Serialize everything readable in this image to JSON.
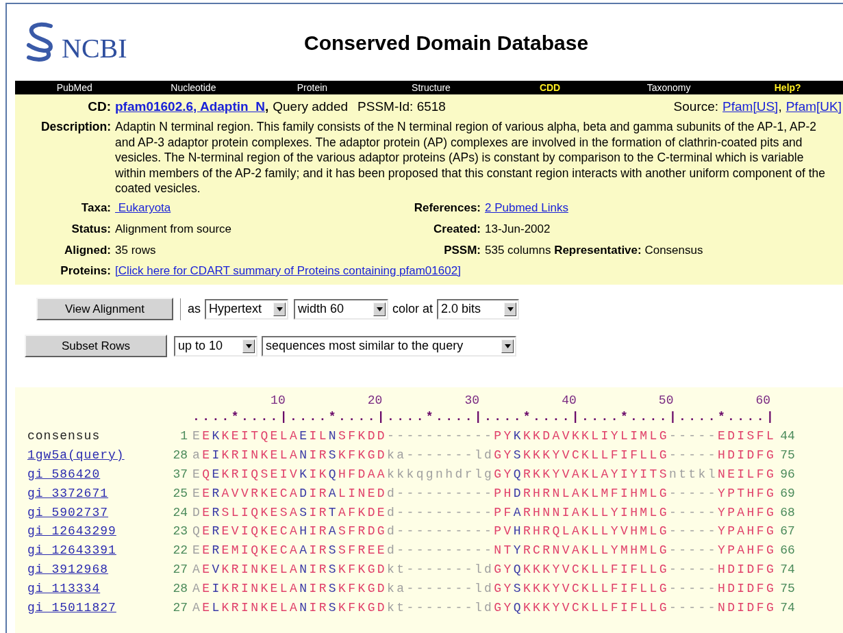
{
  "header": {
    "logo_text": "NCBI",
    "title": "Conserved Domain Database"
  },
  "nav": [
    {
      "label": "PubMed",
      "emphasized": false
    },
    {
      "label": "Nucleotide",
      "emphasized": false
    },
    {
      "label": "Protein",
      "emphasized": false
    },
    {
      "label": "Structure",
      "emphasized": false
    },
    {
      "label": "CDD",
      "emphasized": true
    },
    {
      "label": "Taxonomy",
      "emphasized": false
    },
    {
      "label": "Help?",
      "emphasized": true
    }
  ],
  "cd": {
    "label": "CD:",
    "link": "pfam01602.6, Adaptin_N",
    "comma": ",",
    "note": "Query added",
    "pssm_id": "PSSM-Id: 6518",
    "source_label": "Source:",
    "sources": [
      "Pfam[US]",
      "Pfam[UK]"
    ],
    "source_separator": ","
  },
  "description": {
    "label": "Description:",
    "text": "Adaptin N terminal region. This family consists of the N terminal region of various alpha, beta and gamma subunits of the AP-1, AP-2 and AP-3 adaptor protein complexes. The adaptor protein (AP) complexes are involved in the formation of clathrin-coated pits and vesicles. The N-terminal region of the various adaptor proteins (APs) is constant by comparison to the C-terminal which is variable within members of the AP-2 family; and it has been proposed that this constant region interacts with another uniform component of the coated vesicles."
  },
  "fields": [
    {
      "left": {
        "label": "Taxa:",
        "value": " Eukaryota",
        "kind": "link"
      },
      "right": {
        "label": "References:",
        "value": "2 Pubmed Links",
        "kind": "link"
      }
    },
    {
      "left": {
        "label": "Status:",
        "value": "Alignment from source",
        "kind": "text"
      },
      "right": {
        "label": "Created:",
        "value": "13-Jun-2002",
        "kind": "text"
      }
    },
    {
      "left": {
        "label": "Aligned:",
        "value": "35 rows",
        "kind": "text"
      },
      "right": {
        "label": "PSSM:",
        "value": "535 columns **Representative:** Consensus",
        "kind": "text"
      }
    }
  ],
  "proteins": {
    "label": "Proteins:",
    "link": "[Click here for CDART summary of Proteins containing pfam01602]"
  },
  "controls": {
    "view_button": "View Alignment",
    "as_label": "as",
    "format": "Hypertext",
    "width": "width 60",
    "color_label": "color at",
    "bits": "2.0 bits",
    "subset_button": "Subset Rows",
    "rows": "up to 10",
    "similarity": "sequences most similar to the query"
  },
  "alignment": {
    "ticks": [
      "10",
      "20",
      "30",
      "40",
      "50",
      "60"
    ],
    "ruler": "....*....|....*....|....*....|....*....|....*....|....*....|",
    "rows": [
      {
        "name": "consensus",
        "kind": "plain",
        "start": "1",
        "end": "44",
        "segments": [
          {
            "kind": "low",
            "text": "E"
          },
          {
            "kind": "high",
            "text": "E"
          },
          {
            "kind": "mid",
            "text": "K"
          },
          {
            "kind": "high",
            "text": "KEITQELA"
          },
          {
            "kind": "mid",
            "text": "E"
          },
          {
            "kind": "high",
            "text": "IL"
          },
          {
            "kind": "mid",
            "text": "N"
          },
          {
            "kind": "high",
            "text": "SFKDD"
          },
          {
            "kind": "low",
            "text": "-----------"
          },
          {
            "kind": "high",
            "text": "PY"
          },
          {
            "kind": "mid",
            "text": "K"
          },
          {
            "kind": "high",
            "text": "KKDAVKKLIYLIMLG"
          },
          {
            "kind": "low",
            "text": "-----"
          },
          {
            "kind": "high",
            "text": "EDISFL"
          }
        ]
      },
      {
        "name": "1gw5a(query)",
        "kind": "link",
        "start": "28",
        "end": "75",
        "segments": [
          {
            "kind": "low",
            "text": "a"
          },
          {
            "kind": "high",
            "text": "E"
          },
          {
            "kind": "mid",
            "text": "I"
          },
          {
            "kind": "high",
            "text": "KRINKELA"
          },
          {
            "kind": "mid",
            "text": "N"
          },
          {
            "kind": "high",
            "text": "IR"
          },
          {
            "kind": "mid",
            "text": "S"
          },
          {
            "kind": "high",
            "text": "KFKGD"
          },
          {
            "kind": "low",
            "text": "ka-------ld"
          },
          {
            "kind": "high",
            "text": "GY"
          },
          {
            "kind": "mid",
            "text": "S"
          },
          {
            "kind": "high",
            "text": "KKKYVCKLLFIFLLG"
          },
          {
            "kind": "low",
            "text": "-----"
          },
          {
            "kind": "high",
            "text": "HDIDFG"
          }
        ]
      },
      {
        "name": "gi 586420",
        "kind": "link",
        "start": "37",
        "end": "96",
        "segments": [
          {
            "kind": "low",
            "text": "E"
          },
          {
            "kind": "high",
            "text": "Q"
          },
          {
            "kind": "mid",
            "text": "E"
          },
          {
            "kind": "high",
            "text": "KRIQSEIV"
          },
          {
            "kind": "mid",
            "text": "K"
          },
          {
            "kind": "high",
            "text": "IK"
          },
          {
            "kind": "mid",
            "text": "Q"
          },
          {
            "kind": "high",
            "text": "HFDAA"
          },
          {
            "kind": "low",
            "text": "kkkqgnhdrlg"
          },
          {
            "kind": "high",
            "text": "GY"
          },
          {
            "kind": "mid",
            "text": "Q"
          },
          {
            "kind": "high",
            "text": "RKKYVAKLAYIYITS"
          },
          {
            "kind": "low",
            "text": "nttkl"
          },
          {
            "kind": "high",
            "text": "NEILFG"
          }
        ]
      },
      {
        "name": "gi 3372671",
        "kind": "link",
        "start": "25",
        "end": "69",
        "segments": [
          {
            "kind": "low",
            "text": "E"
          },
          {
            "kind": "high",
            "text": "E"
          },
          {
            "kind": "mid",
            "text": "R"
          },
          {
            "kind": "high",
            "text": "AVVRKECA"
          },
          {
            "kind": "mid",
            "text": "D"
          },
          {
            "kind": "high",
            "text": "IR"
          },
          {
            "kind": "mid",
            "text": "A"
          },
          {
            "kind": "high",
            "text": "LINED"
          },
          {
            "kind": "low",
            "text": "d----------"
          },
          {
            "kind": "high",
            "text": "PH"
          },
          {
            "kind": "mid",
            "text": "D"
          },
          {
            "kind": "high",
            "text": "RHRNLAKLMFIHMLG"
          },
          {
            "kind": "low",
            "text": "-----"
          },
          {
            "kind": "high",
            "text": "YPTHFG"
          }
        ]
      },
      {
        "name": "gi 5902737",
        "kind": "link",
        "start": "24",
        "end": "68",
        "segments": [
          {
            "kind": "low",
            "text": "D"
          },
          {
            "kind": "high",
            "text": "E"
          },
          {
            "kind": "mid",
            "text": "R"
          },
          {
            "kind": "high",
            "text": "SLIQKESA"
          },
          {
            "kind": "mid",
            "text": "S"
          },
          {
            "kind": "high",
            "text": "IR"
          },
          {
            "kind": "mid",
            "text": "T"
          },
          {
            "kind": "high",
            "text": "AFKDE"
          },
          {
            "kind": "low",
            "text": "d----------"
          },
          {
            "kind": "high",
            "text": "PF"
          },
          {
            "kind": "mid",
            "text": "A"
          },
          {
            "kind": "high",
            "text": "RHNNIAKLLYIHMLG"
          },
          {
            "kind": "low",
            "text": "-----"
          },
          {
            "kind": "high",
            "text": "YPAHFG"
          }
        ]
      },
      {
        "name": "gi 12643299",
        "kind": "link",
        "start": "23",
        "end": "67",
        "segments": [
          {
            "kind": "low",
            "text": "Q"
          },
          {
            "kind": "high",
            "text": "E"
          },
          {
            "kind": "mid",
            "text": "R"
          },
          {
            "kind": "high",
            "text": "EVIQKECA"
          },
          {
            "kind": "mid",
            "text": "H"
          },
          {
            "kind": "high",
            "text": "IR"
          },
          {
            "kind": "mid",
            "text": "A"
          },
          {
            "kind": "high",
            "text": "SFRDG"
          },
          {
            "kind": "low",
            "text": "d----------"
          },
          {
            "kind": "high",
            "text": "PV"
          },
          {
            "kind": "mid",
            "text": "H"
          },
          {
            "kind": "high",
            "text": "RHRQLAKLLYVHMLG"
          },
          {
            "kind": "low",
            "text": "-----"
          },
          {
            "kind": "high",
            "text": "YPAHFG"
          }
        ]
      },
      {
        "name": "gi 12643391",
        "kind": "link",
        "start": "22",
        "end": "66",
        "segments": [
          {
            "kind": "low",
            "text": "E"
          },
          {
            "kind": "high",
            "text": "E"
          },
          {
            "kind": "mid",
            "text": "R"
          },
          {
            "kind": "high",
            "text": "EMIQKECA"
          },
          {
            "kind": "mid",
            "text": "A"
          },
          {
            "kind": "high",
            "text": "IR"
          },
          {
            "kind": "mid",
            "text": "S"
          },
          {
            "kind": "high",
            "text": "SFREE"
          },
          {
            "kind": "low",
            "text": "d----------"
          },
          {
            "kind": "high",
            "text": "NT"
          },
          {
            "kind": "mid",
            "text": "Y"
          },
          {
            "kind": "high",
            "text": "RCRNVAKLLYMHMLG"
          },
          {
            "kind": "low",
            "text": "-----"
          },
          {
            "kind": "high",
            "text": "YPAHFG"
          }
        ]
      },
      {
        "name": "gi 3912968",
        "kind": "link",
        "start": "27",
        "end": "74",
        "segments": [
          {
            "kind": "low",
            "text": "A"
          },
          {
            "kind": "high",
            "text": "E"
          },
          {
            "kind": "mid",
            "text": "V"
          },
          {
            "kind": "high",
            "text": "KRINKELA"
          },
          {
            "kind": "mid",
            "text": "N"
          },
          {
            "kind": "high",
            "text": "IR"
          },
          {
            "kind": "mid",
            "text": "S"
          },
          {
            "kind": "high",
            "text": "KFKGD"
          },
          {
            "kind": "low",
            "text": "kt-------ld"
          },
          {
            "kind": "high",
            "text": "GY"
          },
          {
            "kind": "mid",
            "text": "Q"
          },
          {
            "kind": "high",
            "text": "KKKYVCKLLFIFLLG"
          },
          {
            "kind": "low",
            "text": "-----"
          },
          {
            "kind": "high",
            "text": "HDIDFG"
          }
        ]
      },
      {
        "name": "gi 113334",
        "kind": "link",
        "start": "28",
        "end": "75",
        "segments": [
          {
            "kind": "low",
            "text": "A"
          },
          {
            "kind": "high",
            "text": "E"
          },
          {
            "kind": "mid",
            "text": "I"
          },
          {
            "kind": "high",
            "text": "KRINKELA"
          },
          {
            "kind": "mid",
            "text": "N"
          },
          {
            "kind": "high",
            "text": "IR"
          },
          {
            "kind": "mid",
            "text": "S"
          },
          {
            "kind": "high",
            "text": "KFKGD"
          },
          {
            "kind": "low",
            "text": "ka-------ld"
          },
          {
            "kind": "high",
            "text": "GY"
          },
          {
            "kind": "mid",
            "text": "S"
          },
          {
            "kind": "high",
            "text": "KKKYVCKLLFIFLLG"
          },
          {
            "kind": "low",
            "text": "-----"
          },
          {
            "kind": "high",
            "text": "HDIDFG"
          }
        ]
      },
      {
        "name": "gi 15011827",
        "kind": "link",
        "start": "27",
        "end": "74",
        "segments": [
          {
            "kind": "low",
            "text": "A"
          },
          {
            "kind": "high",
            "text": "E"
          },
          {
            "kind": "mid",
            "text": "L"
          },
          {
            "kind": "high",
            "text": "KRINKELA"
          },
          {
            "kind": "mid",
            "text": "N"
          },
          {
            "kind": "high",
            "text": "IR"
          },
          {
            "kind": "mid",
            "text": "S"
          },
          {
            "kind": "high",
            "text": "KFKGD"
          },
          {
            "kind": "low",
            "text": "kt-------ld"
          },
          {
            "kind": "high",
            "text": "GY"
          },
          {
            "kind": "mid",
            "text": "Q"
          },
          {
            "kind": "high",
            "text": "KKKYVCKLLFIFLLG"
          },
          {
            "kind": "low",
            "text": "-----"
          },
          {
            "kind": "high",
            "text": "NDIDFG"
          }
        ]
      }
    ]
  }
}
